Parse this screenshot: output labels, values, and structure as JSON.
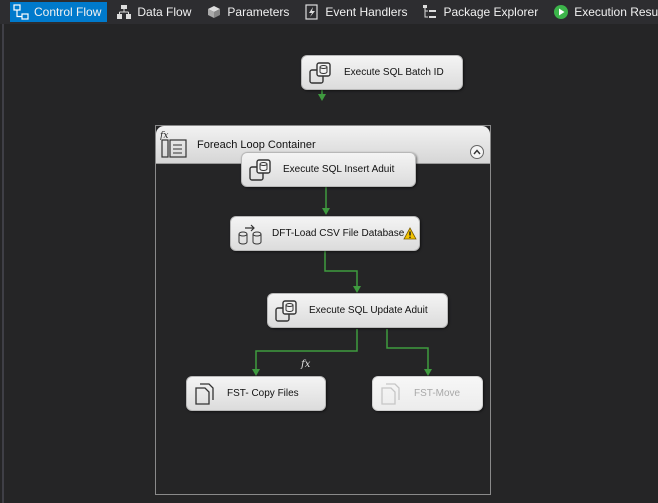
{
  "tabs": [
    {
      "label": "Control Flow",
      "icon": "control-flow-icon",
      "active": true
    },
    {
      "label": "Data Flow",
      "icon": "data-flow-icon",
      "active": false
    },
    {
      "label": "Parameters",
      "icon": "parameters-icon",
      "active": false
    },
    {
      "label": "Event Handlers",
      "icon": "event-handlers-icon",
      "active": false
    },
    {
      "label": "Package Explorer",
      "icon": "package-explorer-icon",
      "active": false
    },
    {
      "label": "Execution Results",
      "icon": "execution-results-icon",
      "active": false
    }
  ],
  "container": {
    "title": "Foreach Loop Container",
    "fx_badge": "fx"
  },
  "tasks": {
    "batch_id": {
      "label": "Execute SQL Batch ID",
      "icon": "execute-sql-icon"
    },
    "insert_audit": {
      "label": "Execute SQL Insert Aduit",
      "icon": "execute-sql-icon"
    },
    "dft_load": {
      "label": "DFT-Load CSV File Database",
      "icon": "data-flow-task-icon",
      "status": "warning"
    },
    "update_audit": {
      "label": "Execute SQL Update Aduit",
      "icon": "execute-sql-icon"
    },
    "copy_files": {
      "label": "FST- Copy Files",
      "icon": "file-system-task-icon"
    },
    "move": {
      "label": "FST-Move",
      "icon": "file-system-task-icon",
      "disabled": true
    }
  },
  "expression_badge": "fx",
  "colors": {
    "accent": "#007acc",
    "canvas": "#252526",
    "connector": "#3f9b3f",
    "warning": "#f2c200"
  }
}
